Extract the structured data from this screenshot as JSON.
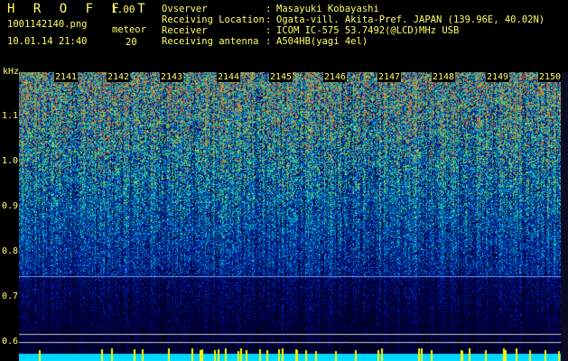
{
  "header": {
    "app_title": "H R O F F T",
    "version": "1.00",
    "filename": "1001142140.png",
    "datetime": "10.01.14 21:40",
    "meteor_label": "meteor",
    "meteor_count": "20"
  },
  "meta": [
    {
      "key": "Ovserver",
      "value": "Masayuki Kobayashi"
    },
    {
      "key": "Receiving Location",
      "value": "Ogata-vill. Akita-Pref. JAPAN (139.96E, 40.02N)"
    },
    {
      "key": "Receiver",
      "value": "ICOM IC-575 53.7492(@LCD)MHz USB"
    },
    {
      "key": "Receiving antenna",
      "value": "A504HB(yagi 4el)"
    }
  ],
  "separator": ":",
  "y_axis": {
    "unit": "kHz",
    "ticks": [
      "1.1",
      "1.0",
      "0.9",
      "0.8",
      "0.7",
      "0.6"
    ]
  },
  "x_axis": {
    "ticks": [
      "2141",
      "2142",
      "2143",
      "2144",
      "2145",
      "2146",
      "2147",
      "2148",
      "2149",
      "2150"
    ]
  },
  "colors": {
    "text": "#ffff66",
    "background": "#000000",
    "baseline": "#00d8ff",
    "line": "#6fa8ff"
  }
}
